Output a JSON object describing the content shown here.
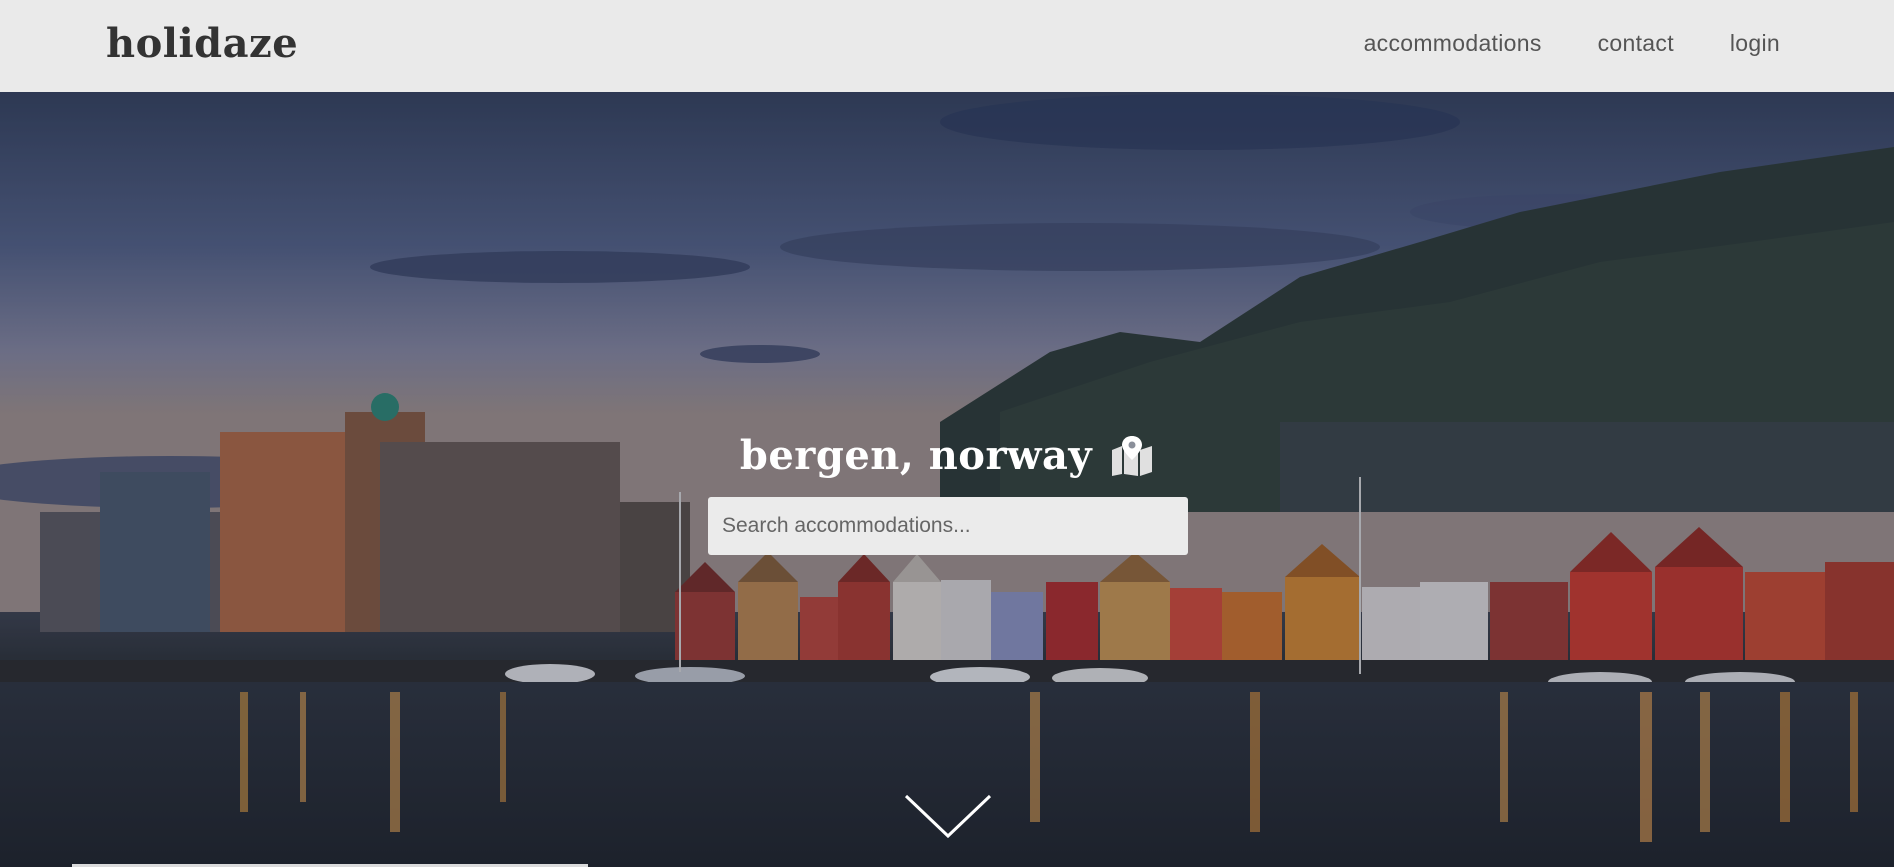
{
  "header": {
    "logo": "holidaze",
    "nav": [
      {
        "label": "accommodations"
      },
      {
        "label": "contact"
      },
      {
        "label": "login"
      }
    ]
  },
  "hero": {
    "title": "bergen, norway",
    "title_icon": "map-marker-icon",
    "search": {
      "placeholder": "Search accommodations...",
      "value": ""
    },
    "scroll_icon": "chevron-down-icon"
  },
  "colors": {
    "header_bg": "#eaeaea",
    "text_dark": "#333333",
    "nav_text": "#555555",
    "hero_title": "#ffffff"
  }
}
